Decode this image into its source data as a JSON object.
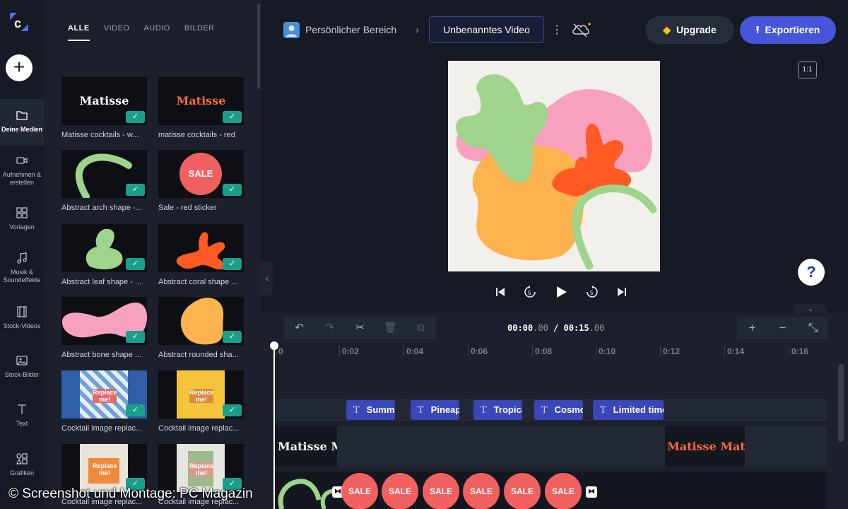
{
  "rail": {
    "items": [
      {
        "label": "Deine Medien",
        "icon": "folder-icon"
      },
      {
        "label": "Aufnehmen & erstellen",
        "icon": "camera-icon"
      },
      {
        "label": "Vorlagen",
        "icon": "templates-icon"
      },
      {
        "label": "Musik & Soundeffekte",
        "icon": "music-icon"
      },
      {
        "label": "Stock-Videos",
        "icon": "film-icon"
      },
      {
        "label": "Stock-Bilder",
        "icon": "image-icon"
      },
      {
        "label": "Text",
        "icon": "text-icon"
      },
      {
        "label": "Grafiken",
        "icon": "shapes-icon"
      }
    ],
    "add_symbol": "+"
  },
  "media": {
    "tabs": [
      "ALLE",
      "VIDEO",
      "AUDIO",
      "BILDER"
    ],
    "active_tab": "ALLE",
    "items": [
      {
        "caption": "Matisse cocktails - w..."
      },
      {
        "caption": "matisse cocktails - red"
      },
      {
        "caption": "Abstract arch shape -..."
      },
      {
        "caption": "Sale - red sticker"
      },
      {
        "caption": "Abstract leaf shape - ..."
      },
      {
        "caption": "Abstract coral shape ..."
      },
      {
        "caption": "Abstract bone shape ..."
      },
      {
        "caption": "Abstract rounded sha..."
      },
      {
        "caption": "Cocktail image replac..."
      },
      {
        "caption": "Cocktail image replac..."
      },
      {
        "caption": "Cocktail image replac..."
      },
      {
        "caption": "Cocktail image replac..."
      }
    ],
    "thumb_text": {
      "matisse": "Matisse",
      "sale": "SALE",
      "replace": "Replace me!"
    }
  },
  "header": {
    "workspace": "Persönlicher Bereich",
    "breadcrumb_sep": "›",
    "project_title": "Unbenanntes Video",
    "more": "⋮",
    "upgrade_label": "Upgrade",
    "export_label": "Exportieren",
    "aspect_ratio": "1:1"
  },
  "player": {
    "timecode_current": "00:00",
    "timecode_current_frac": ".00",
    "timecode_sep": " / ",
    "timecode_total": "00:15",
    "timecode_total_frac": ".00",
    "help": "?"
  },
  "timeline": {
    "ruler": [
      "0",
      "0:02",
      "0:04",
      "0:06",
      "0:08",
      "0:10",
      "0:12",
      "0:14",
      "0:16"
    ],
    "text_clips": [
      "Summe",
      "Pineap",
      "Tropica",
      "Cosmo",
      "Limited time"
    ],
    "logo_clips": [
      "Matisse Ma",
      "Matisse Matisse"
    ],
    "sale_label": "SALE"
  },
  "colors": {
    "accent": "#4655d9",
    "check": "#1aa08a",
    "green": "#9ed48c",
    "pink": "#f7a1bf",
    "orange": "#ff5a24",
    "yellow": "#ffb34f",
    "sale": "#f0605f"
  },
  "watermark": "© Screenshot und Montage: PC Magazin"
}
